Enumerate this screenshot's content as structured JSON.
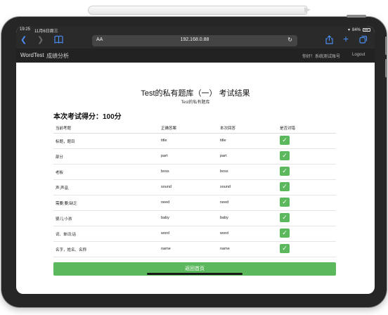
{
  "status_bar": {
    "time": "19:25",
    "date": "11月6日周三",
    "signal": "▾",
    "battery_pct": "84%",
    "battery_level": 0.84
  },
  "browser": {
    "back_icon": "chevron-left-icon",
    "forward_icon": "chevron-right-icon",
    "bookmarks_icon": "book-icon",
    "reader_label": "AA",
    "url": "192.168.0.88",
    "reload_icon": "reload-icon",
    "share_icon": "share-icon",
    "new_tab_icon": "plus-icon",
    "tabs_icon": "tabs-icon"
  },
  "navbar": {
    "brand": "WordTest",
    "analysis": "成绩分析",
    "greeting": "你好！系统测试账号",
    "logout": "Logout"
  },
  "page": {
    "title": "Test的私有题库（一）  考试结果",
    "subtitle": "Test的私有题库",
    "score": "本次考试得分：100分"
  },
  "table": {
    "headers": [
      "当前考题",
      "正确答案",
      "本次回答",
      "是否对错"
    ],
    "rows": [
      {
        "question": "标题，题目",
        "answer": "title",
        "response": "title",
        "correct": true
      },
      {
        "question": "部分",
        "answer": "part",
        "response": "part",
        "correct": true
      },
      {
        "question": "老板",
        "answer": "boss",
        "response": "boss",
        "correct": true
      },
      {
        "question": "声;声音,",
        "answer": "sound",
        "response": "sound",
        "correct": true
      },
      {
        "question": "需要;要;缺乏",
        "answer": "need",
        "response": "need",
        "correct": true
      },
      {
        "question": "婴儿;小孩",
        "answer": "baby",
        "response": "baby",
        "correct": true
      },
      {
        "question": "词、单词;话",
        "answer": "word",
        "response": "word",
        "correct": true
      },
      {
        "question": "名字，姓名、名称",
        "answer": "name",
        "response": "name",
        "correct": true
      }
    ]
  },
  "home_button": "返回首页",
  "colors": {
    "success": "#5cb85c",
    "browser_accent": "#4a8cf0",
    "navbar_bg": "#222222"
  }
}
